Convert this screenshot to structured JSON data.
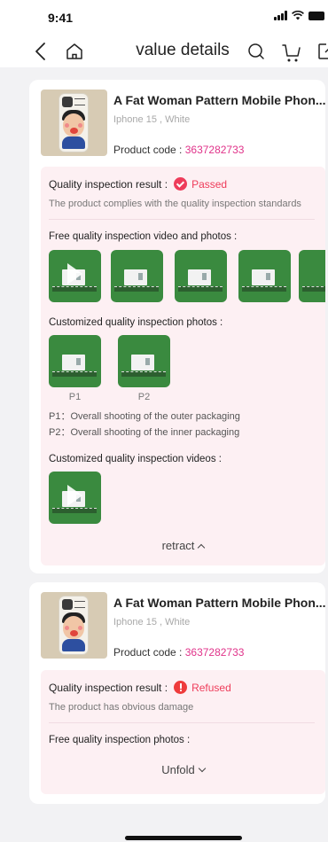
{
  "status_bar": {
    "time": "9:41"
  },
  "nav": {
    "title": "value details"
  },
  "products": [
    {
      "name": "A Fat Woman Pattern Mobile Phon....",
      "variant": "Iphone 15 , White",
      "code_label": "Product code : ",
      "code": "3637282733",
      "result_label": "Quality inspection result :",
      "result_status": "Passed",
      "result_desc": "The product complies with the quality inspection standards",
      "free_title": "Free quality inspection video and photos :",
      "custom_photos_title": "Customized quality inspection photos :",
      "custom_photos": [
        {
          "label": "P1"
        },
        {
          "label": "P2"
        }
      ],
      "photo_legend": [
        "P1：Overall shooting of the outer packaging",
        "P2：Overall shooting of the inner packaging"
      ],
      "custom_videos_title": "Customized quality inspection videos :",
      "toggle_label": "retract"
    },
    {
      "name": "A Fat Woman Pattern Mobile Phon....",
      "variant": "Iphone 15 , White",
      "code_label": "Product code : ",
      "code": "3637282733",
      "result_label": "Quality inspection result :",
      "result_status": "Refused",
      "result_desc": "The product has obvious damage",
      "free_title": "Free quality inspection photos :",
      "toggle_label": "Unfold"
    }
  ],
  "colors": {
    "accent_pink": "#e0338a",
    "status_red": "#ee3c5a",
    "box_bg": "#fdf0f3"
  }
}
